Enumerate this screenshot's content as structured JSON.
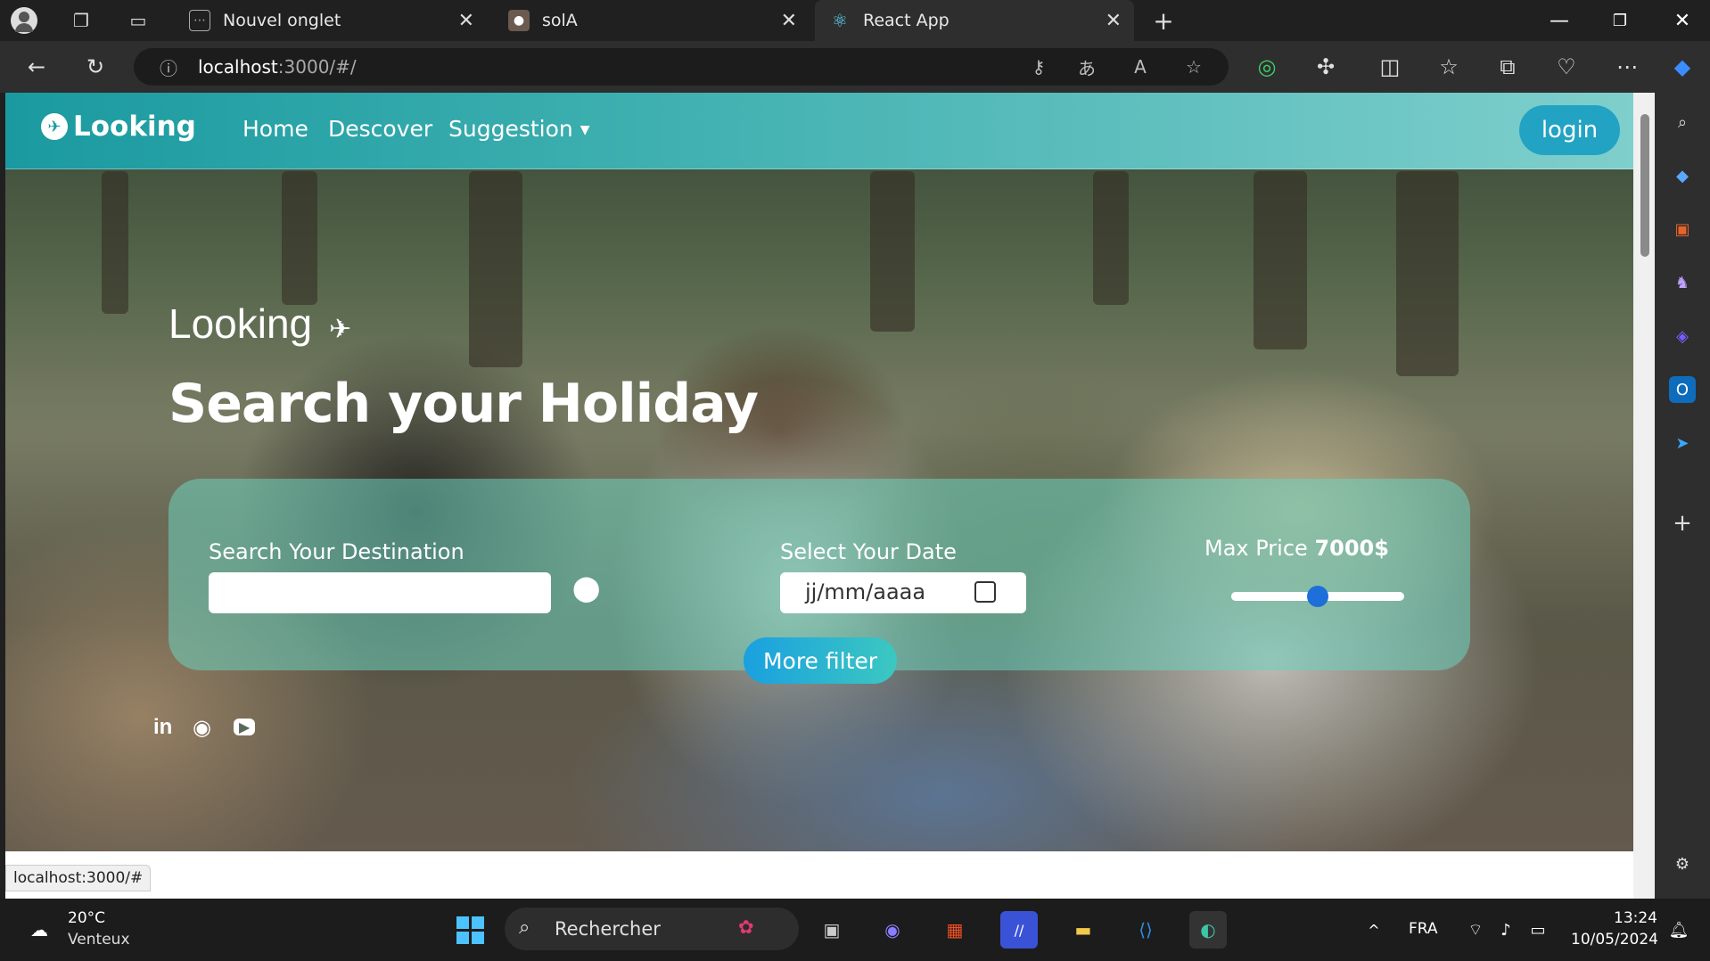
{
  "browser": {
    "tabs": [
      {
        "title": "Nouvel onglet",
        "active": false
      },
      {
        "title": "solA",
        "active": false
      },
      {
        "title": "React App",
        "active": true
      }
    ],
    "url_host": "localhost",
    "url_rest": ":3000/#/",
    "status_link": "localhost:3000/#"
  },
  "site": {
    "brand": "Looking",
    "nav": {
      "home": "Home",
      "discover": "Descover",
      "suggestion": "Suggestion"
    },
    "login": "login",
    "hero": {
      "kicker": "Looking",
      "headline": "Search your Holiday"
    },
    "search": {
      "destination_label": "Search Your Destination",
      "destination_value": "",
      "date_label": "Select Your Date",
      "date_placeholder": "jj/mm/aaaa",
      "price_label": "Max Price",
      "price_value": "7000$",
      "price_fraction": 0.5,
      "more_filter": "More filter"
    },
    "social": {
      "linkedin": "in",
      "github": "◉",
      "youtube": "▶"
    }
  },
  "taskbar": {
    "weather_temp": "20°C",
    "weather_desc": "Venteux",
    "search_placeholder": "Rechercher",
    "lang": "FRA",
    "time": "13:24",
    "date": "10/05/2024"
  },
  "colors": {
    "nav_gradient_start": "#1a9aa0",
    "login_bg": "#22a3c3",
    "slider_thumb": "#1e6fd9"
  }
}
